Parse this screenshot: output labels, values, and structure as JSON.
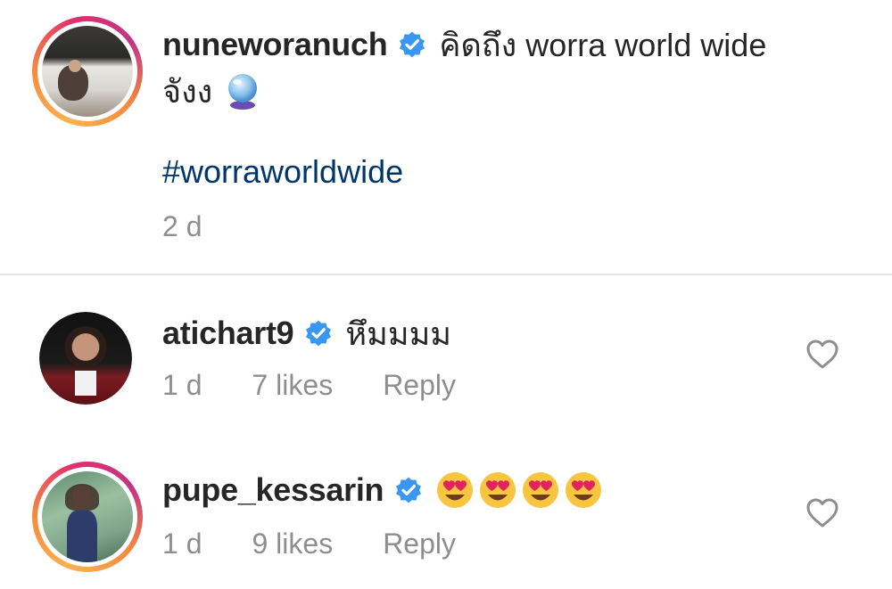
{
  "post": {
    "username": "nuneworanuch",
    "caption_line1": "คิดถึง worra world wide",
    "caption_line2": "จังง",
    "emoji_icon": "crystal-ball-icon",
    "hashtag": "#worraworldwide",
    "time": "2 d"
  },
  "comments": [
    {
      "username": "atichart9",
      "text": "หึมมมม",
      "time": "1 d",
      "likes": "7 likes",
      "reply": "Reply"
    },
    {
      "username": "pupe_kessarin",
      "text": "",
      "emoji_icons": [
        "heart-eyes-emoji",
        "heart-eyes-emoji",
        "heart-eyes-emoji",
        "heart-eyes-emoji"
      ],
      "time": "1 d",
      "likes": "9 likes",
      "reply": "Reply"
    }
  ],
  "colors": {
    "link": "#00376b",
    "muted": "#8e8e8e",
    "verified": "#3897f0"
  }
}
